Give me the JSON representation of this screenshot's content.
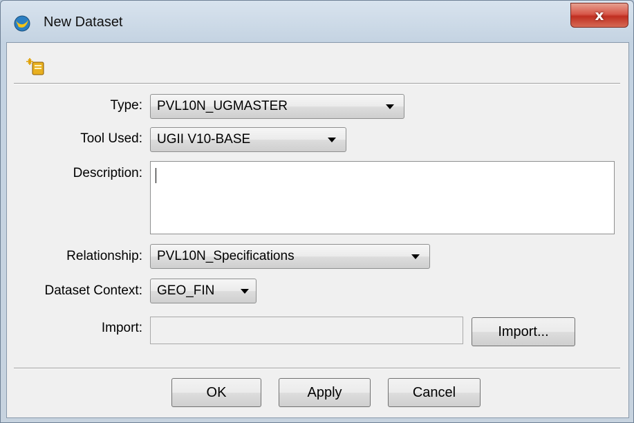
{
  "window": {
    "title": "New Dataset",
    "close_glyph": "x"
  },
  "icons": {
    "app_icon": "teamcenter-app-icon",
    "toolbar_icon": "new-dataset-wizard-icon"
  },
  "form": {
    "type": {
      "label": "Type:",
      "value": "PVL10N_UGMASTER"
    },
    "tool_used": {
      "label": "Tool Used:",
      "value": "UGII V10-BASE"
    },
    "description": {
      "label": "Description:",
      "value": ""
    },
    "relationship": {
      "label": "Relationship:",
      "value": "PVL10N_Specifications"
    },
    "dataset_context": {
      "label": "Dataset Context:",
      "value": "GEO_FIN"
    },
    "import": {
      "label": "Import:",
      "value": "",
      "button_label": "Import..."
    }
  },
  "buttons": {
    "ok": "OK",
    "apply": "Apply",
    "cancel": "Cancel"
  },
  "colors": {
    "close_button": "#c9392a",
    "dialog_background": "#f0f0f0"
  }
}
